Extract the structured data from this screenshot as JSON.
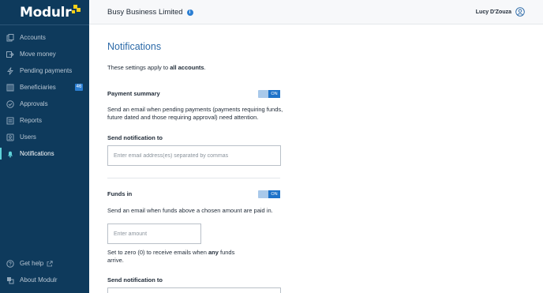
{
  "sidebar": {
    "logo_text": "Modulr",
    "items": [
      {
        "label": "Accounts",
        "icon": "accounts-icon"
      },
      {
        "label": "Move money",
        "icon": "move-money-icon"
      },
      {
        "label": "Pending payments",
        "icon": "lightning-icon"
      },
      {
        "label": "Beneficiaries",
        "icon": "beneficiaries-icon",
        "badge": "46"
      },
      {
        "label": "Approvals",
        "icon": "check-circle-icon"
      },
      {
        "label": "Reports",
        "icon": "reports-icon"
      },
      {
        "label": "Users",
        "icon": "users-icon"
      },
      {
        "label": "Notifications",
        "icon": "bell-icon",
        "active": true
      }
    ],
    "bottom": [
      {
        "label": "Get help",
        "icon": "help-icon"
      },
      {
        "label": "About Modulr",
        "icon": "about-icon"
      }
    ]
  },
  "header": {
    "company": "Busy Business Limited",
    "user": "Lucy D'Zouza"
  },
  "main": {
    "title": "Notifications",
    "intro_prefix": "These settings apply to ",
    "intro_bold": "all accounts",
    "intro_suffix": ".",
    "payment_summary": {
      "title": "Payment summary",
      "toggle": "ON",
      "description": "Send an email when pending payments (payments requiring funds, future dated and those requiring approval) need attention.",
      "send_to_label": "Send notification to",
      "email_placeholder": "Enter email address(es) separated by commas"
    },
    "funds_in": {
      "title": "Funds in",
      "toggle": "ON",
      "description": "Send an email when funds above a chosen amount are paid in.",
      "amount_placeholder": "Enter amount",
      "hint_prefix": "Set to zero (0) to receive emails when ",
      "hint_bold": "any",
      "hint_suffix": " funds arrive.",
      "send_to_label": "Send notification to"
    }
  },
  "colors": {
    "sidebar_bg": "#0e3a5c",
    "accent": "#1f73c9",
    "logo_accent": "#f5d01a",
    "active_marker": "#5ed1d8"
  }
}
